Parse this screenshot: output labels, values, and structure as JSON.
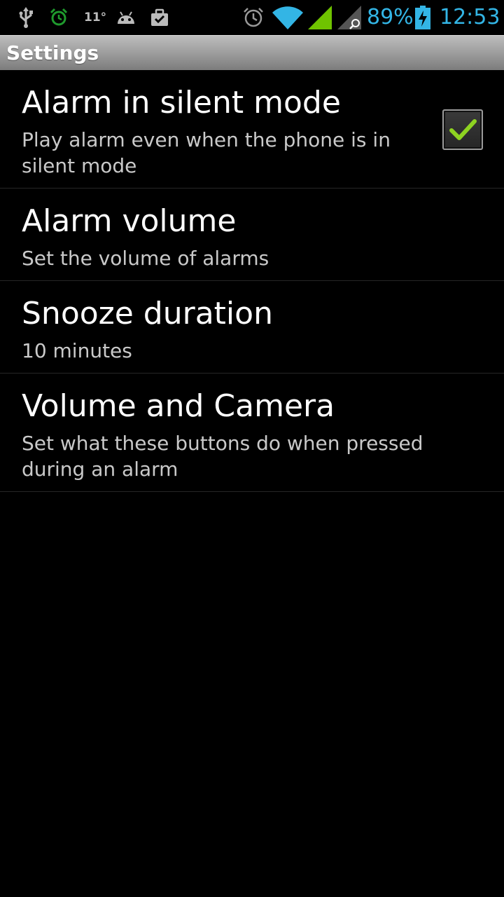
{
  "status_bar": {
    "temperature": "11°",
    "battery_percent": "89%",
    "time": "12:53",
    "icons": [
      "usb-icon",
      "alarm-clock-green-icon",
      "android-icon",
      "briefcase-check-icon",
      "alarm-icon",
      "wifi-icon",
      "signal-icon",
      "signal-roaming-icon",
      "battery-charging-icon"
    ],
    "accent_color": "#33b5e5",
    "signal_color": "#6fc300"
  },
  "header": {
    "title": "Settings"
  },
  "preferences": [
    {
      "title": "Alarm in silent mode",
      "summary": "Play alarm even when the phone is in silent mode",
      "checked": true,
      "check_color": "#8ed321"
    },
    {
      "title": "Alarm volume",
      "summary": "Set the volume of alarms"
    },
    {
      "title": "Snooze duration",
      "summary": "10 minutes"
    },
    {
      "title": "Volume and Camera",
      "summary": "Set what these buttons do when pressed during an alarm"
    }
  ]
}
